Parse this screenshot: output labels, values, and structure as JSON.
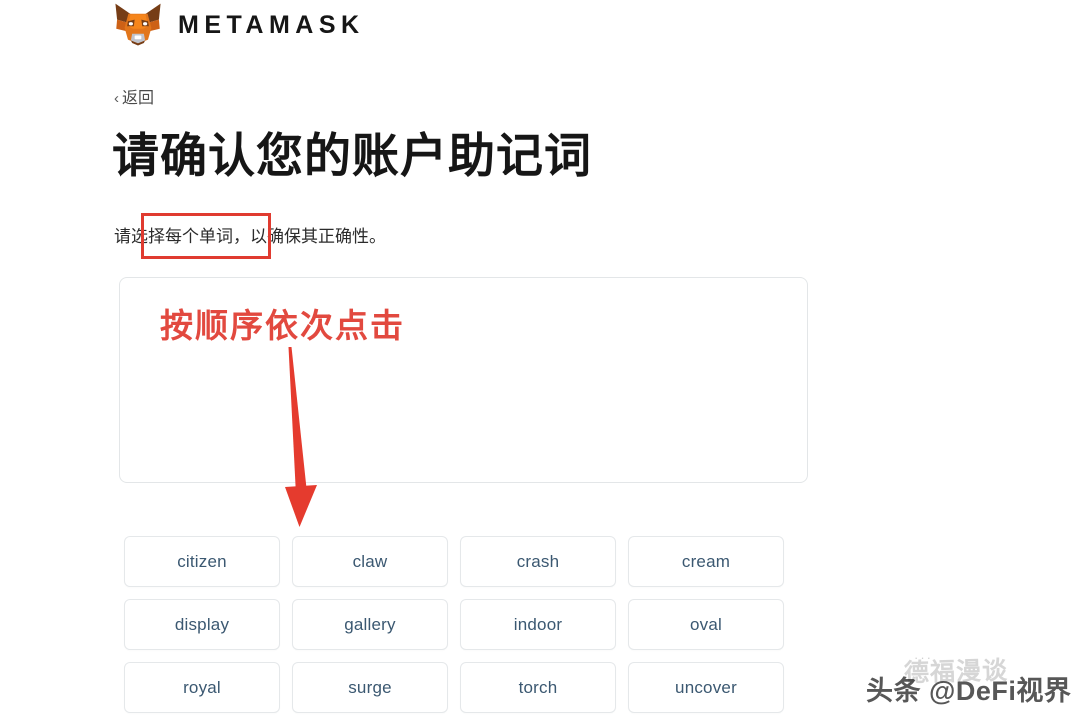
{
  "brand": {
    "wordmark": "METAMASK",
    "logo_icon": "metamask-fox-logo",
    "fox_colors": {
      "light": "#e2761b",
      "mid": "#cd6116",
      "dark": "#763d16",
      "pale": "#f6851b",
      "cream": "#e4761b",
      "white": "#ffffff",
      "grey": "#c0c4cd"
    }
  },
  "nav": {
    "back_label": "返回",
    "back_chevron": "chevron-left-icon"
  },
  "page": {
    "title": "请确认您的账户助记词",
    "subtitle": "请选择每个单词，以确保其正确性。"
  },
  "annotations": {
    "highlight_box": {
      "name": "red-highlight-rectangle",
      "color": "#e03b30",
      "covers_text": "选择每个单词"
    },
    "instruction_text": "按顺序依次点击",
    "instruction_color": "#e2493f",
    "arrow": {
      "name": "red-down-arrow",
      "color": "#e53b2e"
    }
  },
  "dropzone": {
    "name": "selected-words-dropzone",
    "border_color": "#e3e6e8",
    "selected_words": []
  },
  "word_bank": {
    "text_color": "#3b5871",
    "border_color": "#e5e8ea",
    "words": [
      "citizen",
      "claw",
      "crash",
      "cream",
      "display",
      "gallery",
      "indoor",
      "oval",
      "royal",
      "surge",
      "torch",
      "uncover"
    ]
  },
  "watermark": {
    "front": "头条 @DeFi视界",
    "back": "德福漫谈",
    "dots": "···"
  }
}
